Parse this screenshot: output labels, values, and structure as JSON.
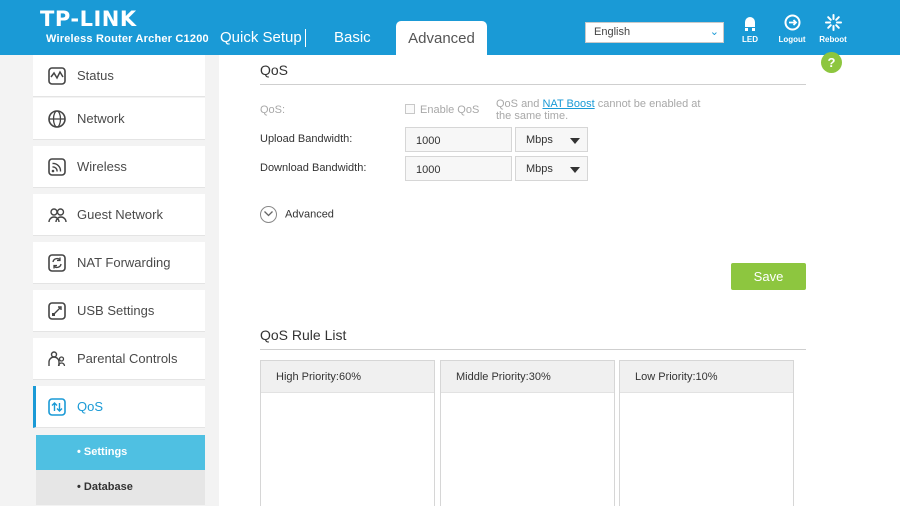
{
  "header": {
    "brand": "TP-LINK",
    "model": "Wireless Router Archer C1200",
    "tabs": {
      "quick_setup": "Quick Setup",
      "basic": "Basic",
      "advanced": "Advanced"
    },
    "language": "English",
    "buttons": {
      "led": "LED",
      "logout": "Logout",
      "reboot": "Reboot"
    }
  },
  "sidebar": {
    "items": [
      {
        "label": "Status",
        "icon": "status-icon"
      },
      {
        "label": "Network",
        "icon": "globe-icon"
      },
      {
        "label": "Wireless",
        "icon": "wifi-icon"
      },
      {
        "label": "Guest Network",
        "icon": "guests-icon"
      },
      {
        "label": "NAT Forwarding",
        "icon": "nat-icon"
      },
      {
        "label": "USB Settings",
        "icon": "usb-icon"
      },
      {
        "label": "Parental Controls",
        "icon": "parental-icon"
      },
      {
        "label": "QoS",
        "icon": "qos-icon"
      }
    ],
    "subitems": [
      {
        "label": "Settings"
      },
      {
        "label": "Database"
      }
    ]
  },
  "main": {
    "qos_title": "QoS",
    "help": "?",
    "qos_label": "QoS:",
    "enable_qos": "Enable QoS",
    "note_pre": "QoS and ",
    "note_link": "NAT Boost",
    "note_post": " cannot be enabled at the same time.",
    "upload_label": "Upload Bandwidth:",
    "upload_value": "1000",
    "upload_unit": "Mbps",
    "download_label": "Download Bandwidth:",
    "download_value": "1000",
    "download_unit": "Mbps",
    "advanced_label": "Advanced",
    "save_label": "Save",
    "rule_list_title": "QoS Rule List",
    "rule_columns": [
      "High Priority:60%",
      "Middle Priority:30%",
      "Low Priority:10%"
    ]
  },
  "colors": {
    "brand_blue": "#1a9ad6",
    "active_sub": "#4fc0e2",
    "save_green": "#8dc63f"
  }
}
